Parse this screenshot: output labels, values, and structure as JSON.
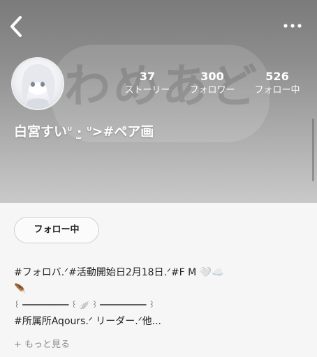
{
  "header": {
    "watermark_text": "わめあど",
    "back_icon": "chevron-left-icon",
    "more_icon": "more-horizontal-icon"
  },
  "profile": {
    "name": "白宮すいᐡ ·̫ ᐡ>#ペア画",
    "stats": [
      {
        "value": "37",
        "label": "ストーリー"
      },
      {
        "value": "300",
        "label": "フォロワー"
      },
      {
        "value": "526",
        "label": "フォロー中"
      }
    ]
  },
  "follow_button": {
    "label": "フォロー中"
  },
  "bio": {
    "lines": [
      "#フォロバ.ᐟ#活動開始日2月18日.ᐟ#F M 🤍☁️",
      "🪶",
      "꒰ ━━━━━━━━━━ ꒰ 🪽 ꒱ ━━━━━━━━━━ ꒱",
      "#所属所Aqours.ᐟ リーダー.ᐟ他..."
    ]
  },
  "more_link": {
    "label": "+ もっと見る"
  },
  "colors": {
    "header_top": "#7b7b7b",
    "header_bottom": "#c9c9c9",
    "background": "#f6f6f6"
  }
}
